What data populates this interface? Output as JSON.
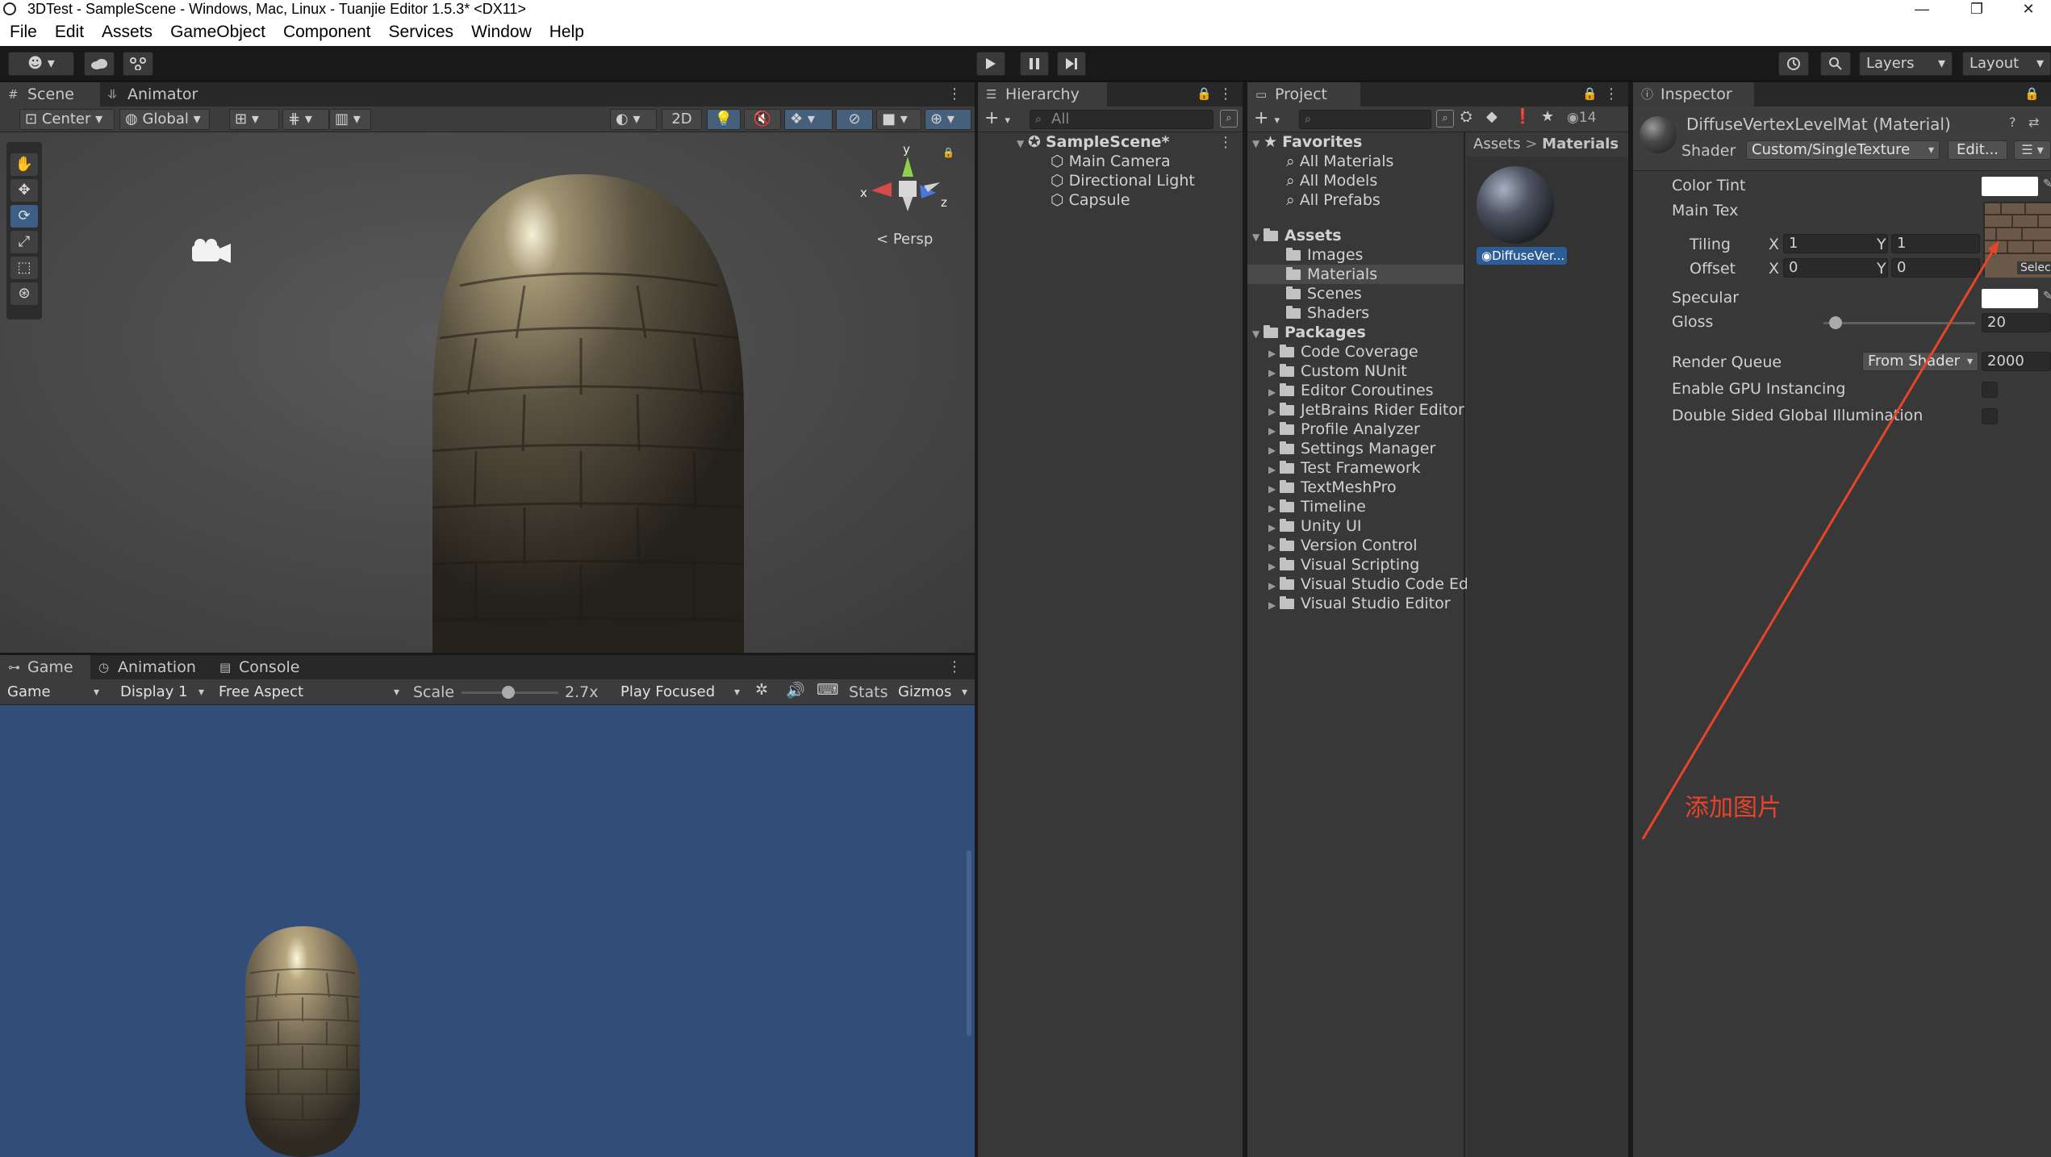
{
  "window": {
    "title": "3DTest - SampleScene - Windows, Mac, Linux - Tuanjie Editor 1.5.3* <DX11>",
    "controls": [
      "—",
      "❐",
      "✕"
    ]
  },
  "menu": [
    "File",
    "Edit",
    "Assets",
    "GameObject",
    "Component",
    "Services",
    "Window",
    "Help"
  ],
  "toolbar": {
    "account_glyph": "☻",
    "layers": "Layers",
    "layout": "Layout"
  },
  "scene_panel": {
    "tabs": [
      "Scene",
      "Animator"
    ],
    "pivot": "Center",
    "space": "Global",
    "mode_2d": "2D",
    "gizmo_view": "Persp",
    "axis_labels": {
      "x": "x",
      "y": "y",
      "z": "z"
    }
  },
  "game_panel": {
    "tabs": [
      "Game",
      "Animation",
      "Console"
    ],
    "view": "Game",
    "display": "Display 1",
    "aspect": "Free Aspect",
    "scale_label": "Scale",
    "scale_value": "2.7x",
    "scale_fraction": 0.48,
    "play_mode": "Play Focused",
    "stats": "Stats",
    "gizmos": "Gizmos"
  },
  "hierarchy": {
    "tab": "Hierarchy",
    "search_placeholder": "All",
    "scene": "SampleScene*",
    "items": [
      "Main Camera",
      "Directional Light",
      "Capsule"
    ]
  },
  "project": {
    "tab": "Project",
    "favorites": {
      "label": "Favorites",
      "items": [
        "All Materials",
        "All Models",
        "All Prefabs"
      ]
    },
    "assets": {
      "label": "Assets",
      "items": [
        "Images",
        "Materials",
        "Scenes",
        "Shaders"
      ]
    },
    "packages": {
      "label": "Packages",
      "items": [
        "Code Coverage",
        "Custom NUnit",
        "Editor Coroutines",
        "JetBrains Rider Editor",
        "Profile Analyzer",
        "Settings Manager",
        "Test Framework",
        "TextMeshPro",
        "Timeline",
        "Unity UI",
        "Version Control",
        "Visual Scripting",
        "Visual Studio Code Edi",
        "Visual Studio Editor"
      ]
    },
    "breadcrumb": [
      "Assets",
      "Materials"
    ],
    "breadcrumb_sep": ">",
    "asset_name": "DiffuseVer...",
    "hidden_count": "14"
  },
  "inspector": {
    "tab": "Inspector",
    "material_name": "DiffuseVertexLevelMat (Material)",
    "shader_label": "Shader",
    "shader_value": "Custom/SingleTexture",
    "edit_button": "Edit...",
    "color_tint": "Color Tint",
    "main_tex": "Main Tex",
    "tiling": "Tiling",
    "offset": "Offset",
    "tiling_x": "1",
    "tiling_y": "1",
    "offset_x": "0",
    "offset_y": "0",
    "axis_x": "X",
    "axis_y": "Y",
    "select": "Selec",
    "specular": "Specular",
    "gloss": "Gloss",
    "gloss_value": "20",
    "gloss_fraction": 0.08,
    "render_queue": "Render Queue",
    "render_queue_mode": "From Shader",
    "render_queue_value": "2000",
    "gpu_instancing": "Enable GPU Instancing",
    "double_sided_gi": "Double Sided Global Illumination"
  },
  "annotation": {
    "text": "添加图片",
    "color": "#e8442a"
  }
}
